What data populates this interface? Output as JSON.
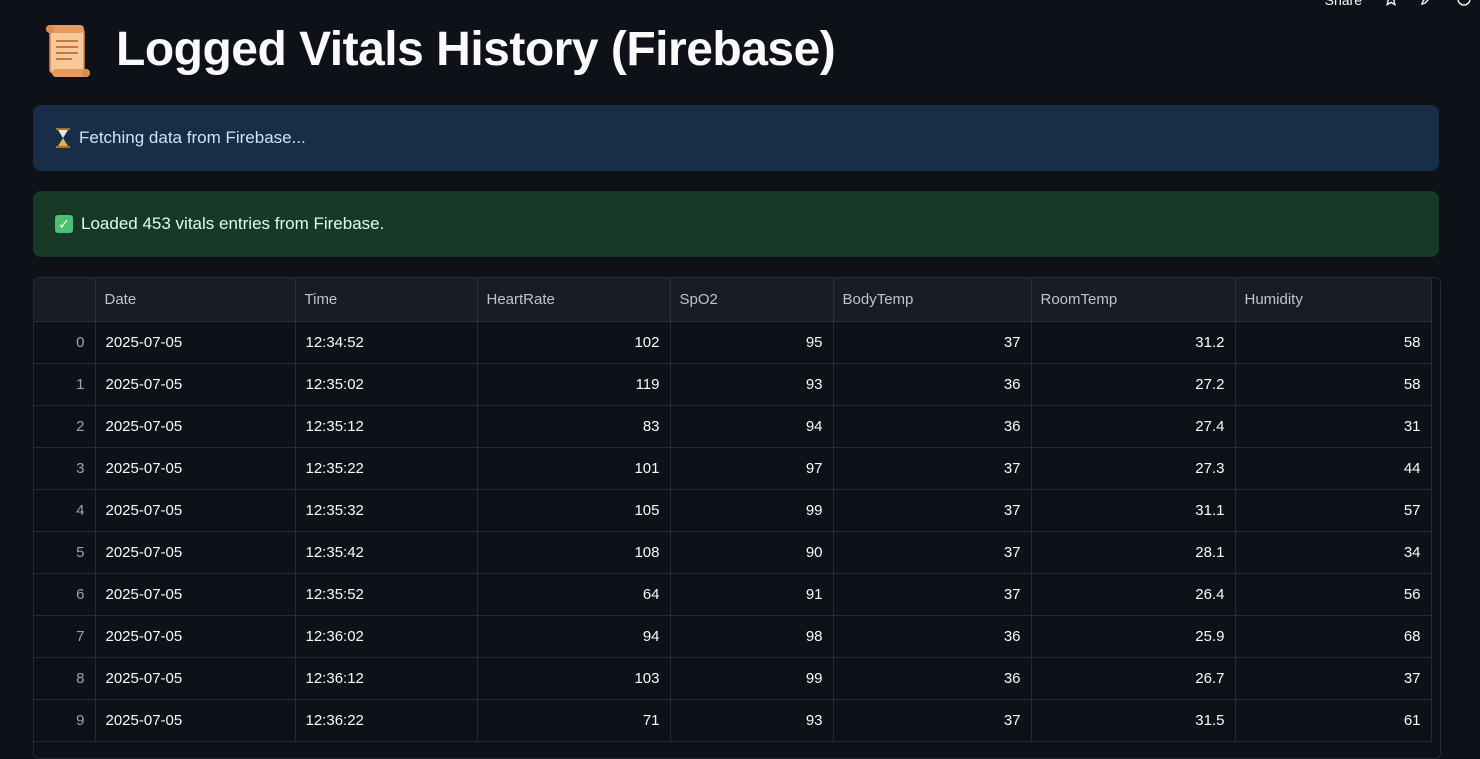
{
  "topbar": {
    "share_label": "Share",
    "star_icon": "star-icon",
    "edit_icon": "pencil-icon",
    "github_icon": "github-icon"
  },
  "page": {
    "title": "Logged Vitals History (Firebase)",
    "title_icon": "scroll-icon"
  },
  "alerts": {
    "info": {
      "icon": "hourglass-icon",
      "text": "Fetching data from Firebase..."
    },
    "success": {
      "icon": "check-mark-icon",
      "text": "Loaded 453 vitals entries from Firebase."
    }
  },
  "colors": {
    "background": "#0e1117",
    "info_bg": "#172d48",
    "success_bg": "#173928",
    "success_check": "#4cc172"
  },
  "table": {
    "columns": [
      "",
      "Date",
      "Time",
      "HeartRate",
      "SpO2",
      "BodyTemp",
      "RoomTemp",
      "Humidity"
    ],
    "rows": [
      [
        "0",
        "2025-07-05",
        "12:34:52",
        "102",
        "95",
        "37",
        "31.2",
        "58"
      ],
      [
        "1",
        "2025-07-05",
        "12:35:02",
        "119",
        "93",
        "36",
        "27.2",
        "58"
      ],
      [
        "2",
        "2025-07-05",
        "12:35:12",
        "83",
        "94",
        "36",
        "27.4",
        "31"
      ],
      [
        "3",
        "2025-07-05",
        "12:35:22",
        "101",
        "97",
        "37",
        "27.3",
        "44"
      ],
      [
        "4",
        "2025-07-05",
        "12:35:32",
        "105",
        "99",
        "37",
        "31.1",
        "57"
      ],
      [
        "5",
        "2025-07-05",
        "12:35:42",
        "108",
        "90",
        "37",
        "28.1",
        "34"
      ],
      [
        "6",
        "2025-07-05",
        "12:35:52",
        "64",
        "91",
        "37",
        "26.4",
        "56"
      ],
      [
        "7",
        "2025-07-05",
        "12:36:02",
        "94",
        "98",
        "36",
        "25.9",
        "68"
      ],
      [
        "8",
        "2025-07-05",
        "12:36:12",
        "103",
        "99",
        "36",
        "26.7",
        "37"
      ],
      [
        "9",
        "2025-07-05",
        "12:36:22",
        "71",
        "93",
        "37",
        "31.5",
        "61"
      ]
    ]
  }
}
